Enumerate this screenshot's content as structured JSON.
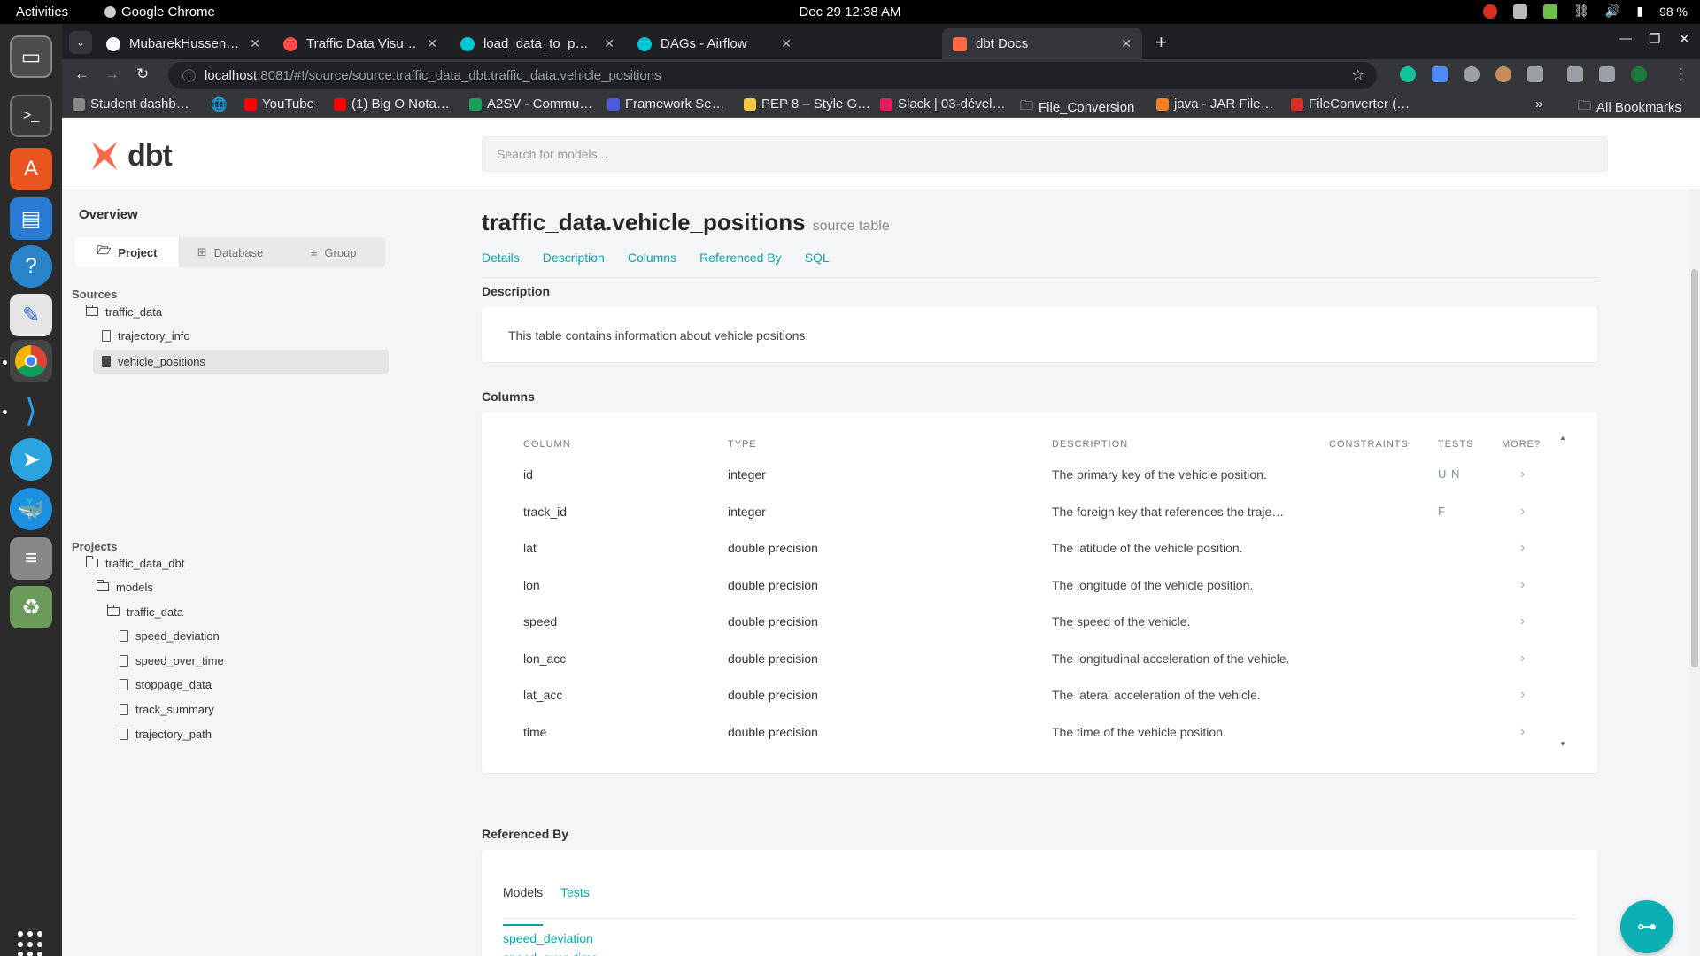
{
  "topbar": {
    "activities": "Activities",
    "app_name": "Google Chrome",
    "clock": "Dec 29  12:38 AM",
    "battery": "98 %"
  },
  "tabs": [
    {
      "title": "MubarekHussen/traffic-",
      "favicon_color": "#ffffff"
    },
    {
      "title": "Traffic Data Visualizatio",
      "favicon_color": "#ff4b4b"
    },
    {
      "title": "load_data_to_postgres -",
      "favicon_color": "#00c7d4"
    },
    {
      "title": "DAGs - Airflow",
      "favicon_color": "#00c7d4"
    },
    {
      "title": "dbt Docs",
      "favicon_color": "#ff694b"
    }
  ],
  "address": {
    "host": "localhost",
    "path": ":8081/#!/source/source.traffic_data_dbt.traffic_data.vehicle_positions"
  },
  "bookmarks": [
    "Student dashb…",
    "YouTube",
    "(1) Big O Nota…",
    "A2SV - Commu…",
    "Framework Se…",
    "PEP 8 – Style G…",
    "Slack | 03-dével…",
    "File_Conversion",
    "java - JAR File…",
    "FileConverter (…",
    "All Bookmarks"
  ],
  "dbt": {
    "logo_text": "dbt",
    "search_placeholder": "Search for models...",
    "overview": "Overview",
    "segments": [
      "Project",
      "Database",
      "Group"
    ],
    "sources_label": "Sources",
    "source_folder": "traffic_data",
    "source_tables": [
      "trajectory_info",
      "vehicle_positions"
    ],
    "projects_label": "Projects",
    "project_name": "traffic_data_dbt",
    "models_folder": "models",
    "models_subfolder": "traffic_data",
    "models": [
      "speed_deviation",
      "speed_over_time",
      "stoppage_data",
      "track_summary",
      "trajectory_path"
    ],
    "title": "traffic_data.vehicle_positions",
    "title_sub": "source table",
    "subnav": [
      "Details",
      "Description",
      "Columns",
      "Referenced By",
      "SQL"
    ],
    "description_label": "Description",
    "description_text": "This table contains information about vehicle positions.",
    "columns_label": "Columns",
    "column_headers": [
      "COLUMN",
      "TYPE",
      "DESCRIPTION",
      "CONSTRAINTS",
      "TESTS",
      "MORE?"
    ],
    "columns": [
      {
        "name": "id",
        "type": "integer",
        "description": "The primary key of the vehicle position.",
        "tests": "U N"
      },
      {
        "name": "track_id",
        "type": "integer",
        "description": "The foreign key that references the traje…",
        "tests": "F"
      },
      {
        "name": "lat",
        "type": "double precision",
        "description": "The latitude of the vehicle position.",
        "tests": ""
      },
      {
        "name": "lon",
        "type": "double precision",
        "description": "The longitude of the vehicle position.",
        "tests": ""
      },
      {
        "name": "speed",
        "type": "double precision",
        "description": "The speed of the vehicle.",
        "tests": ""
      },
      {
        "name": "lon_acc",
        "type": "double precision",
        "description": "The longitudinal acceleration of the vehicle.",
        "tests": ""
      },
      {
        "name": "lat_acc",
        "type": "double precision",
        "description": "The lateral acceleration of the vehicle.",
        "tests": ""
      },
      {
        "name": "time",
        "type": "double precision",
        "description": "The time of the vehicle position.",
        "tests": ""
      }
    ],
    "referenced_label": "Referenced By",
    "ref_tabs": [
      "Models",
      "Tests"
    ],
    "ref_models": [
      "speed_deviation",
      "speed_over_time"
    ]
  },
  "colors": {
    "accent": "#0aa5ab",
    "dbt_orange": "#ff694b"
  }
}
